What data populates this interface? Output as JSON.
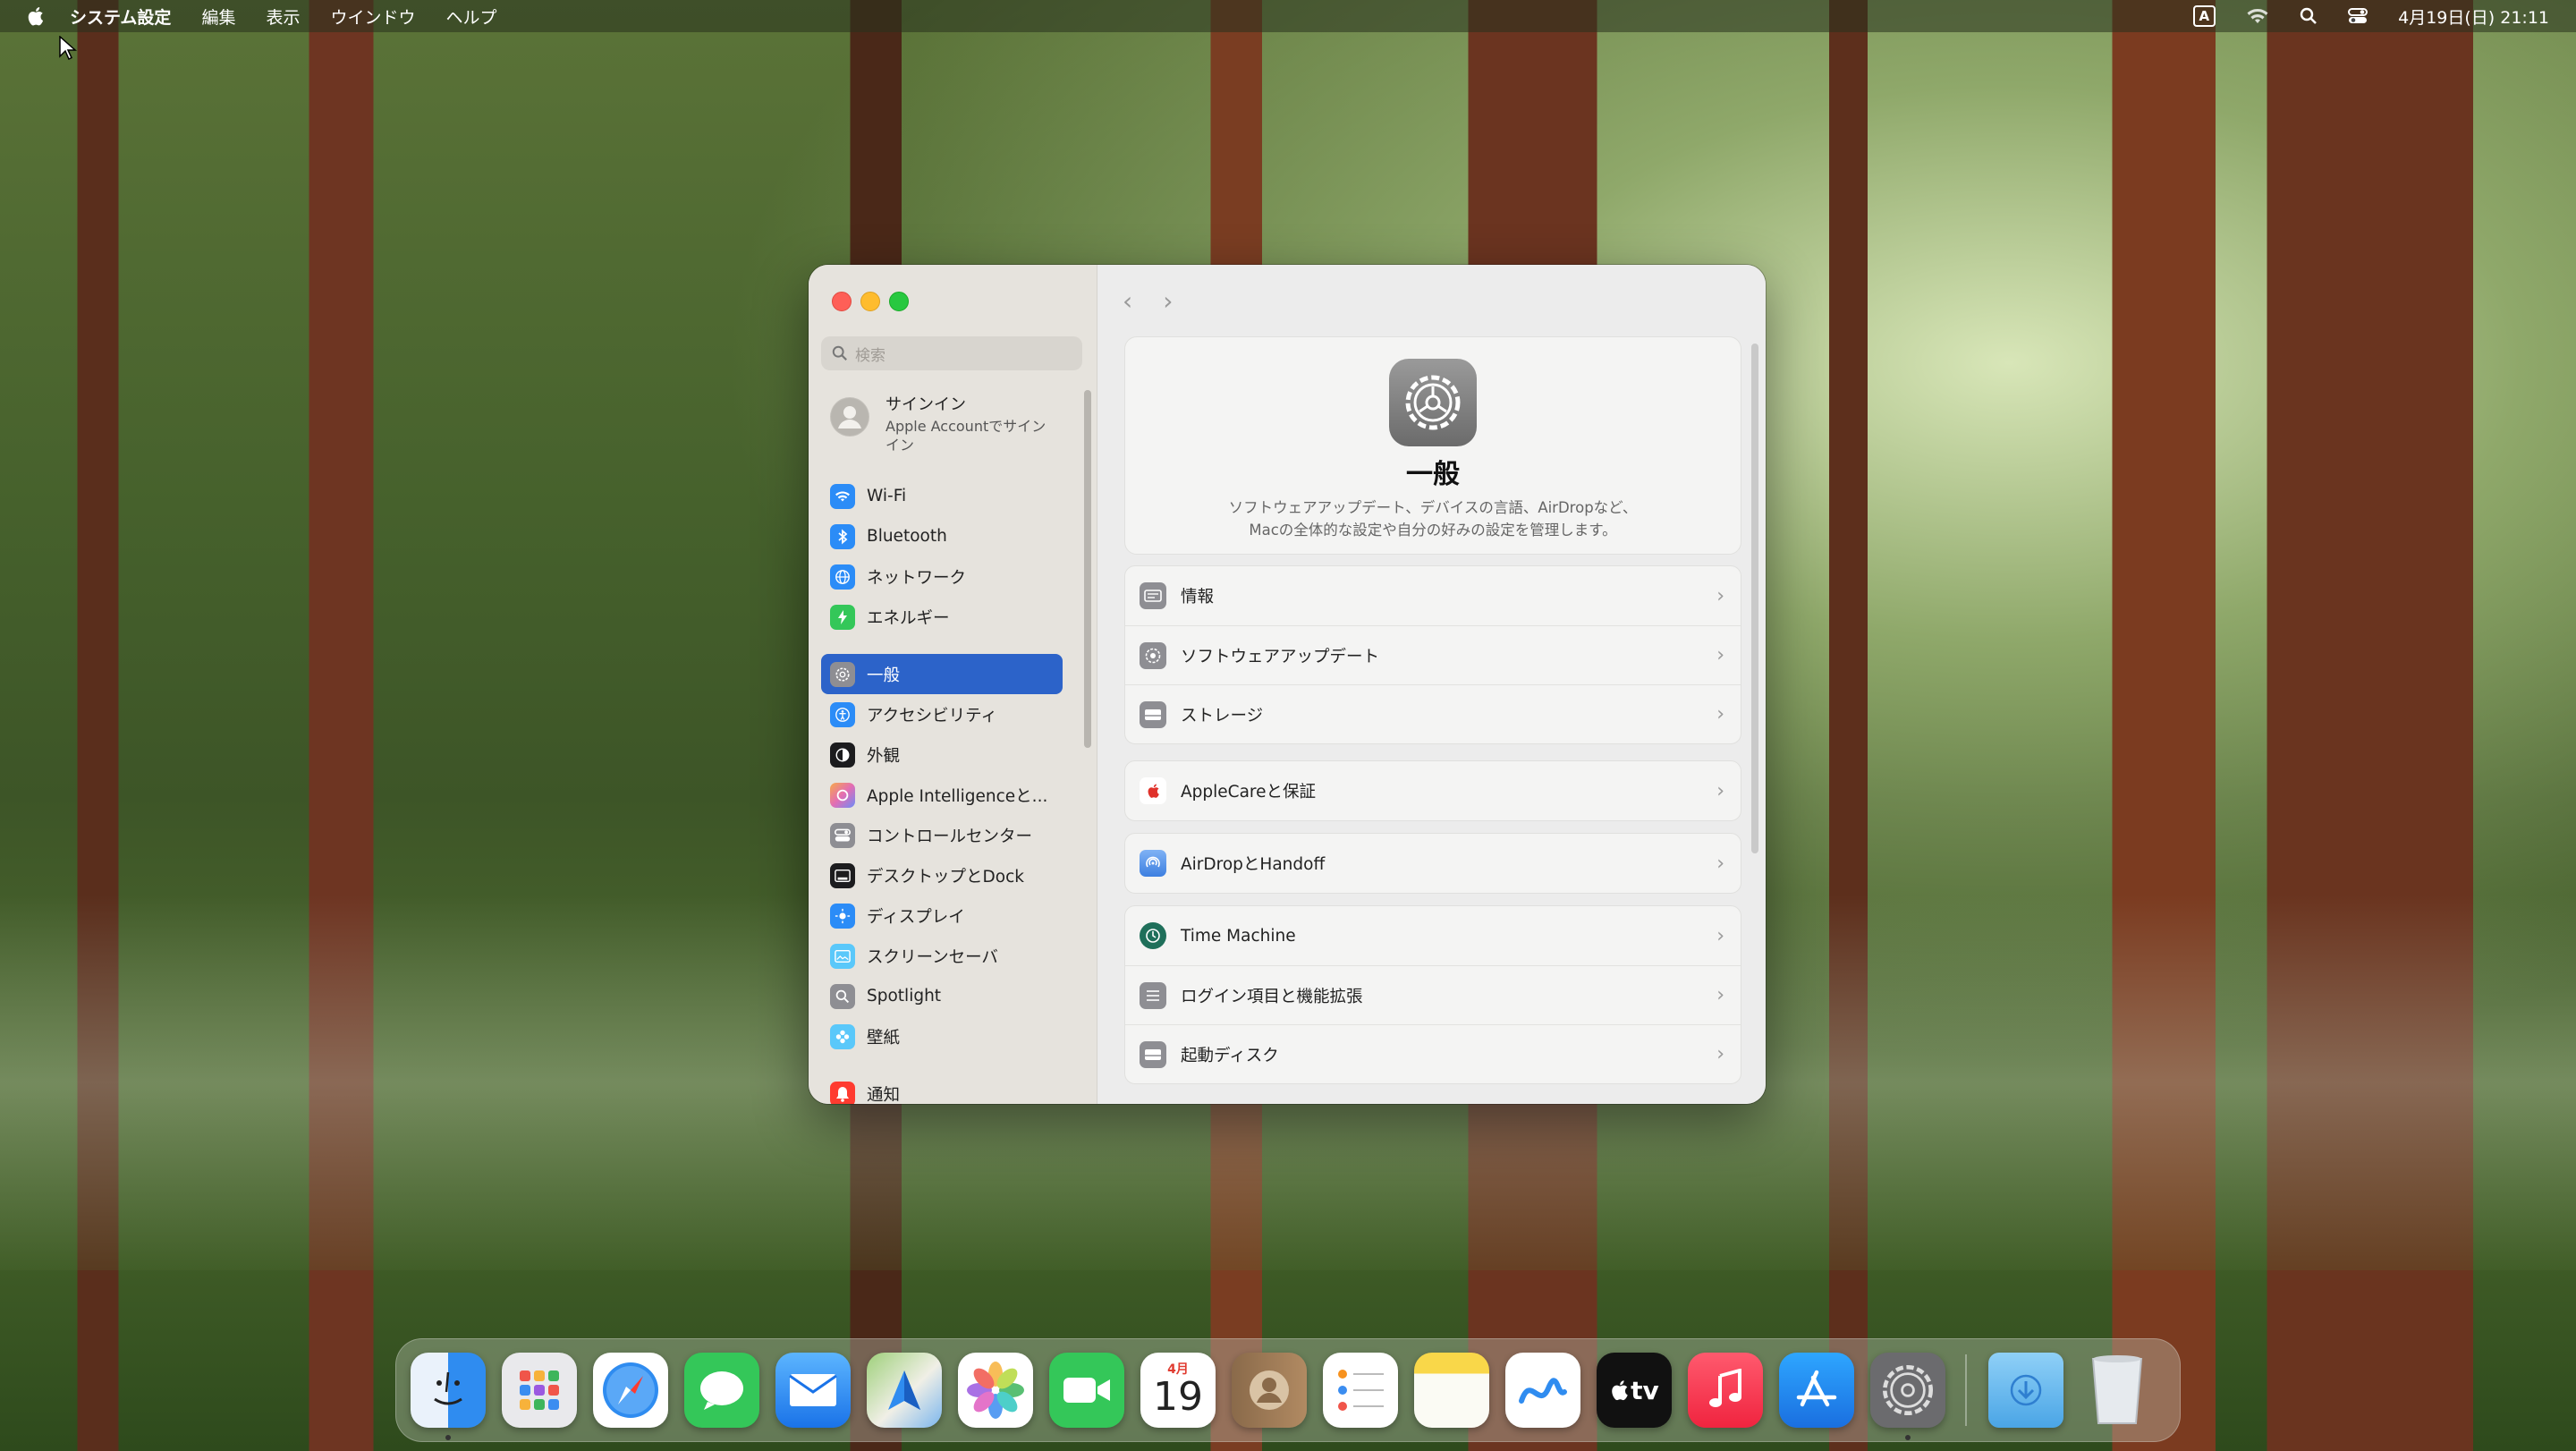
{
  "menubar": {
    "app_name": "システム設定",
    "items": [
      "編集",
      "表示",
      "ウインドウ",
      "ヘルプ"
    ],
    "input_badge": "A",
    "datetime": "4月19日(日) 21:11"
  },
  "sidebar": {
    "search_placeholder": "検索",
    "signin": {
      "title": "サインイン",
      "subtitle": "Apple Accountでサインイン"
    },
    "items": [
      {
        "label": "Wi-Fi",
        "color": "#2b8cf7",
        "icon": "wifi-icon"
      },
      {
        "label": "Bluetooth",
        "color": "#2b8cf7",
        "icon": "bluetooth-icon"
      },
      {
        "label": "ネットワーク",
        "color": "#2b8cf7",
        "icon": "globe-icon"
      },
      {
        "label": "エネルギー",
        "color": "#34c759",
        "icon": "bolt-icon"
      },
      {
        "label": "一般",
        "color": "#8e8e93",
        "icon": "gear-icon",
        "active": true
      },
      {
        "label": "アクセシビリティ",
        "color": "#2b8cf7",
        "icon": "accessibility-icon"
      },
      {
        "label": "外観",
        "color": "#1c1c1e",
        "icon": "appearance-icon"
      },
      {
        "label": "Apple Intelligenceと...",
        "color": "#e36db3",
        "icon": "apple-intelligence-icon"
      },
      {
        "label": "コントロールセンター",
        "color": "#8e8e93",
        "icon": "control-center-icon"
      },
      {
        "label": "デスクトップとDock",
        "color": "#1c1c1e",
        "icon": "desktop-dock-icon"
      },
      {
        "label": "ディスプレイ",
        "color": "#2b8cf7",
        "icon": "sun-icon"
      },
      {
        "label": "スクリーンセーバ",
        "color": "#5ac8fa",
        "icon": "screensaver-icon"
      },
      {
        "label": "Spotlight",
        "color": "#8e8e93",
        "icon": "search-icon"
      },
      {
        "label": "壁紙",
        "color": "#5ac8fa",
        "icon": "flower-icon"
      },
      {
        "label": "通知",
        "color": "#ff3b30",
        "icon": "bell-icon"
      }
    ]
  },
  "content": {
    "title": "一般",
    "description_line1": "ソフトウェアアップデート、デバイスの言語、AirDropなど、",
    "description_line2": "Macの全体的な設定や自分の好みの設定を管理します。",
    "group1": [
      {
        "label": "情報",
        "icon": "info-icon"
      },
      {
        "label": "ソフトウェアアップデート",
        "icon": "software-update-icon"
      },
      {
        "label": "ストレージ",
        "icon": "storage-icon"
      }
    ],
    "group2": [
      {
        "label": "AppleCareと保証",
        "icon": "applecare-icon"
      }
    ],
    "group3": [
      {
        "label": "AirDropとHandoff",
        "icon": "airdrop-icon"
      }
    ],
    "group4": [
      {
        "label": "Time Machine",
        "icon": "time-machine-icon"
      },
      {
        "label": "ログイン項目と機能拡張",
        "icon": "login-items-icon"
      },
      {
        "label": "起動ディスク",
        "icon": "startup-disk-icon"
      }
    ]
  },
  "dock": {
    "calendar_month": "4月",
    "calendar_day": "19",
    "tv_label": "tv",
    "apps": [
      "Finder",
      "Launchpad",
      "Safari",
      "メッセージ",
      "メール",
      "マップ",
      "写真",
      "FaceTime",
      "カレンダー",
      "連絡先",
      "リマインダー",
      "メモ",
      "フリーボード",
      "TV",
      "ミュージック",
      "App Store",
      "システム設定",
      "ダウンロード",
      "ゴミ箱"
    ]
  }
}
